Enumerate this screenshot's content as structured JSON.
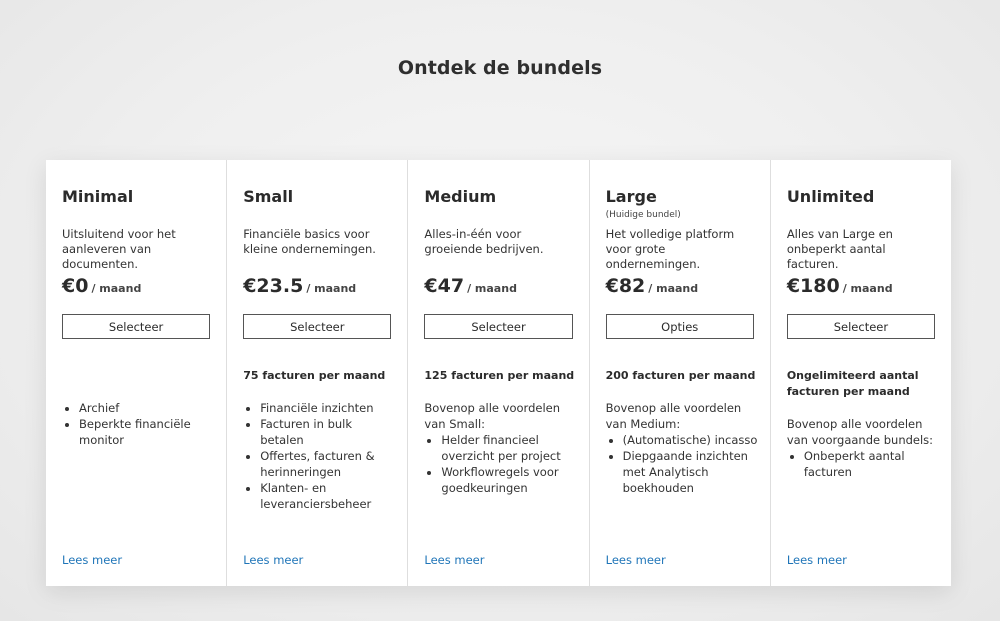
{
  "page": {
    "title": "Ontdek de bundels"
  },
  "plans": [
    {
      "name": "Minimal",
      "tag": "",
      "description": "Uitsluitend voor het aanleveren van documenten.",
      "price": "€0",
      "unit": "/ maand",
      "button": "Selecteer",
      "quota": "",
      "intro": "",
      "features": [
        "Archief",
        "Beperkte financiële monitor"
      ],
      "link": "Lees meer"
    },
    {
      "name": "Small",
      "tag": "",
      "description": "Financiële basics voor kleine ondernemingen.",
      "price": "€23.5",
      "unit": "/ maand",
      "button": "Selecteer",
      "quota": "75 facturen per maand",
      "intro": "",
      "features": [
        "Financiële inzichten",
        "Facturen in bulk betalen",
        "Offertes, facturen & herinneringen",
        "Klanten- en leveranciersbeheer"
      ],
      "link": "Lees meer"
    },
    {
      "name": "Medium",
      "tag": "",
      "description": "Alles-in-één voor groeiende bedrijven.",
      "price": "€47",
      "unit": "/ maand",
      "button": "Selecteer",
      "quota": "125 facturen per maand",
      "intro": "Bovenop alle voordelen van Small:",
      "features": [
        "Helder financieel overzicht per project",
        "Workflowregels voor goedkeuringen"
      ],
      "link": "Lees meer"
    },
    {
      "name": "Large",
      "tag": "(Huidige bundel)",
      "description": "Het volledige platform voor grote ondernemingen.",
      "price": "€82",
      "unit": "/ maand",
      "button": "Opties",
      "quota": "200 facturen per maand",
      "intro": "Bovenop alle voordelen van Medium:",
      "features": [
        "(Automatische) incasso",
        "Diepgaande inzichten met Analytisch boekhouden"
      ],
      "link": "Lees meer"
    },
    {
      "name": "Unlimited",
      "tag": "",
      "description": "Alles van Large en onbeperkt aantal facturen.",
      "price": "€180",
      "unit": "/ maand",
      "button": "Selecteer",
      "quota": "Ongelimiteerd aantal facturen per maand",
      "intro": "Bovenop alle voordelen van voorgaande bundels:",
      "features": [
        "Onbeperkt aantal facturen"
      ],
      "link": "Lees meer"
    }
  ]
}
